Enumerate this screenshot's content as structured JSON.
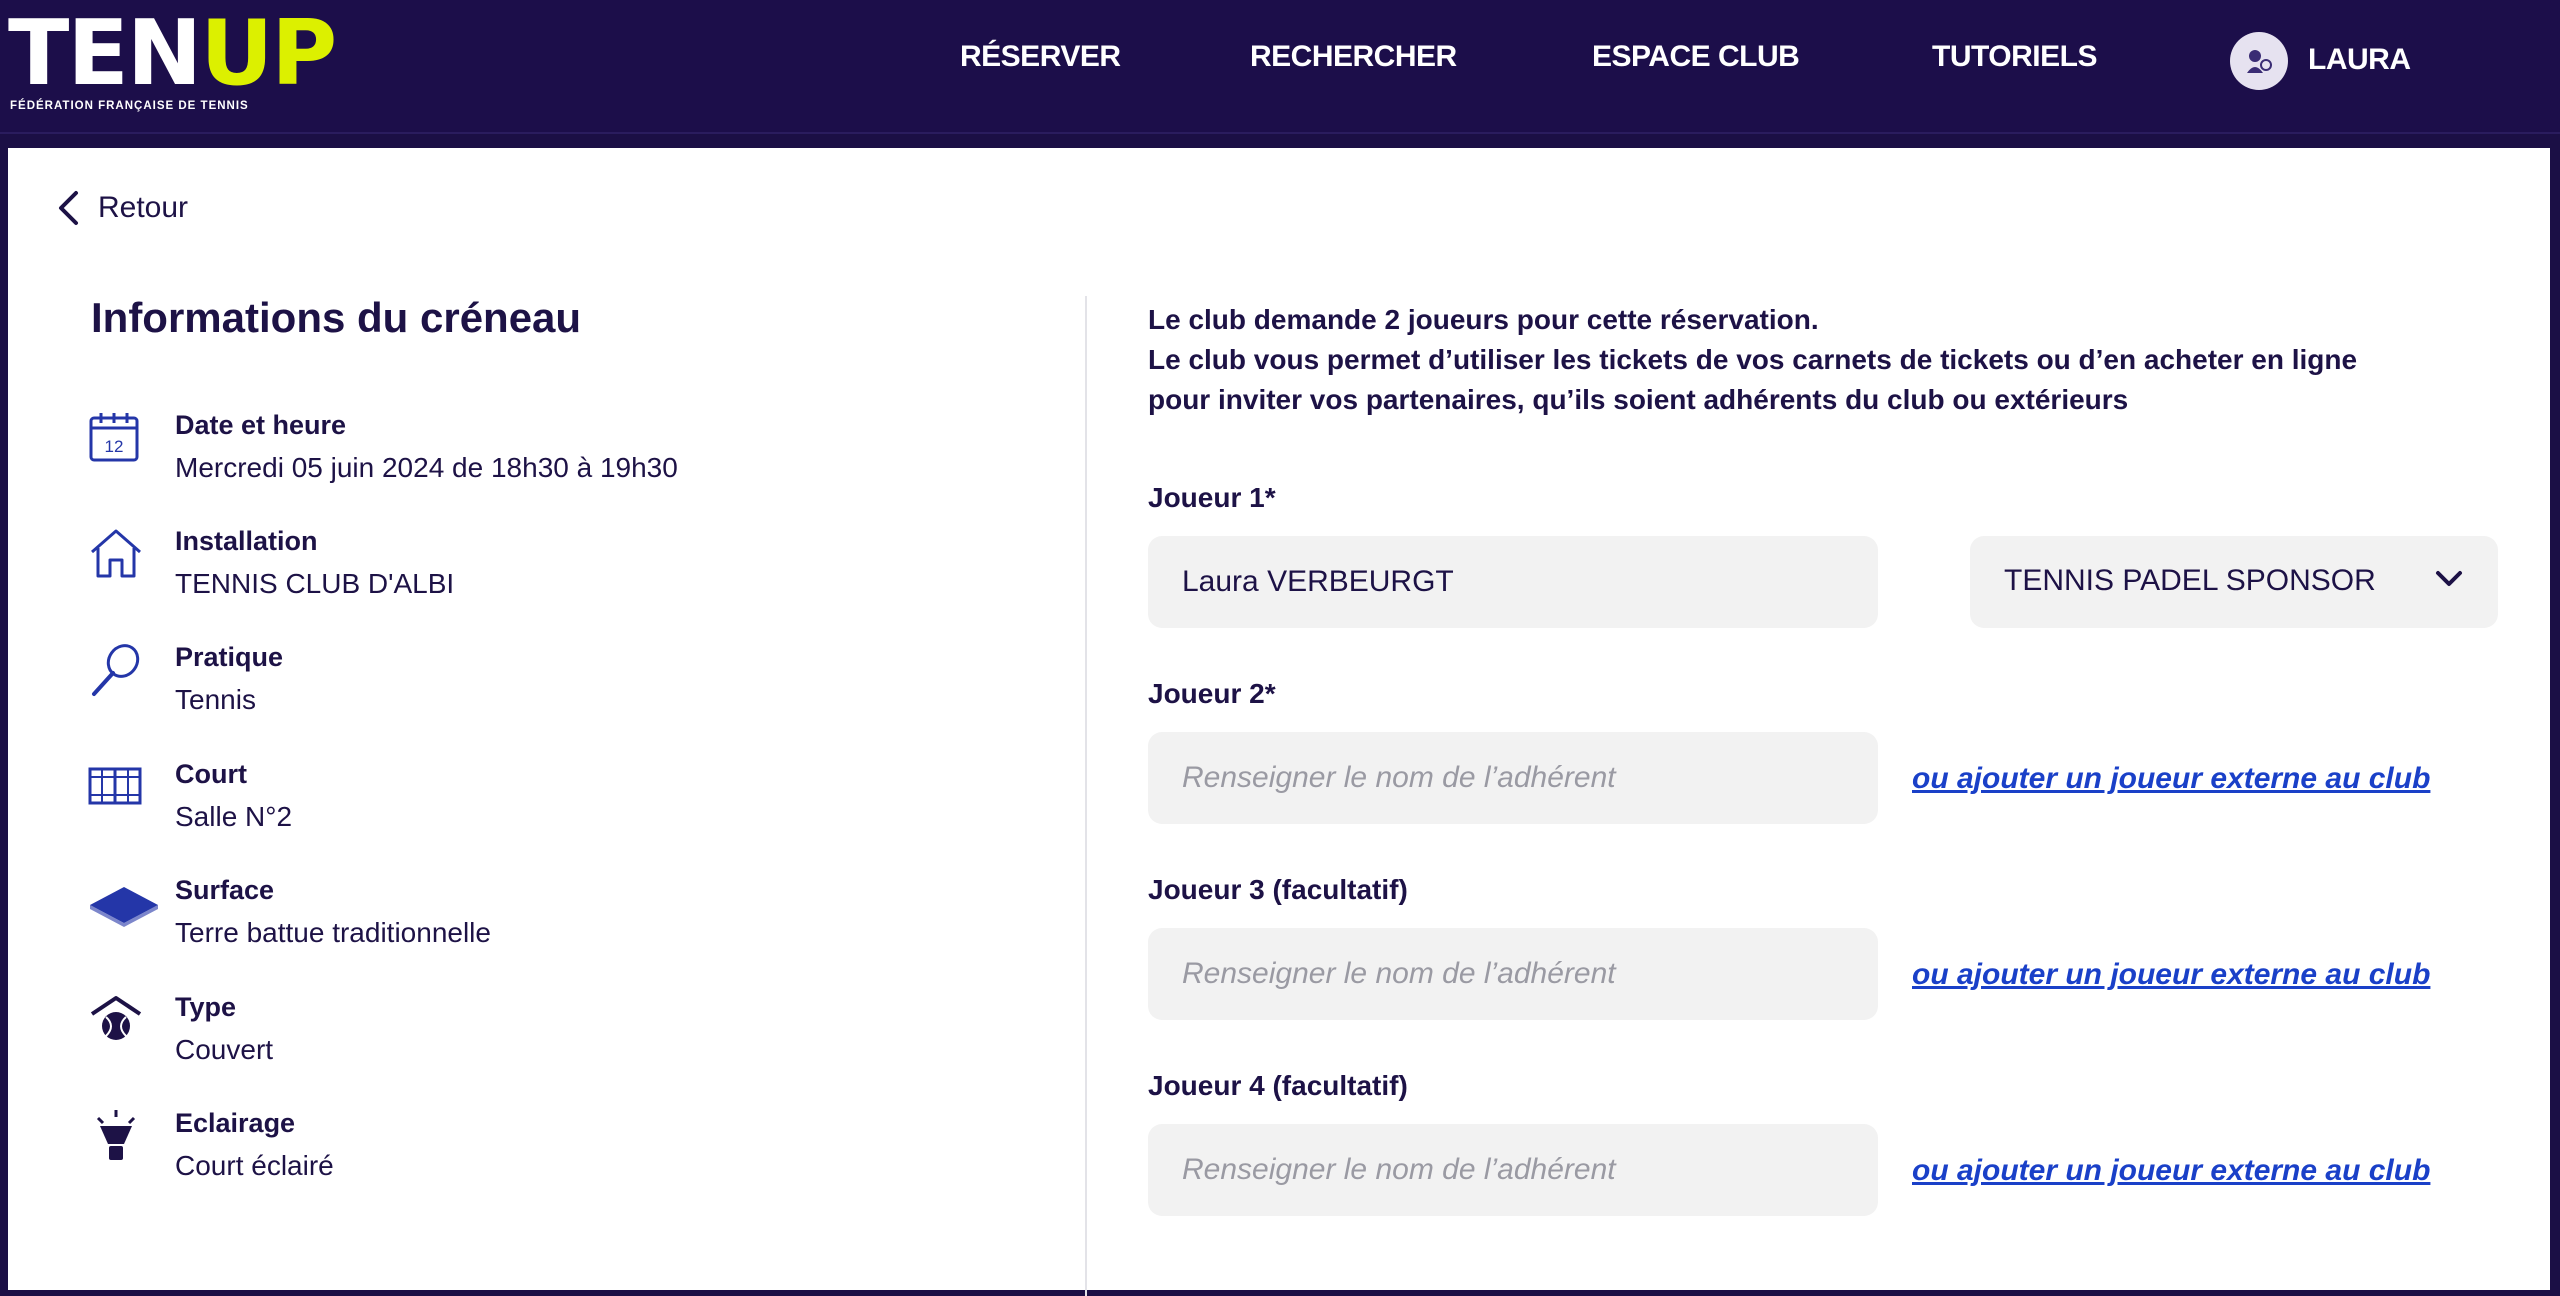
{
  "header": {
    "logo": {
      "ten": "TEN",
      "up": "UP",
      "subtitle": "FÉDÉRATION FRANÇAISE DE TENNIS"
    },
    "nav": [
      {
        "label": "RÉSERVER"
      },
      {
        "label": "RECHERCHER"
      },
      {
        "label": "ESPACE CLUB"
      },
      {
        "label": "TUTORIELS"
      }
    ],
    "user": {
      "name": "LAURA"
    }
  },
  "back": {
    "label": "Retour"
  },
  "slot": {
    "title": "Informations du créneau",
    "rows": [
      {
        "icon": "calendar-icon",
        "label": "Date et heure",
        "value": "Mercredi 05 juin 2024 de 18h30 à 19h30",
        "icon_text": "12"
      },
      {
        "icon": "house-icon",
        "label": "Installation",
        "value": "TENNIS CLUB D'ALBI"
      },
      {
        "icon": "racket-icon",
        "label": "Pratique",
        "value": "Tennis"
      },
      {
        "icon": "court-icon",
        "label": "Court",
        "value": "Salle N°2"
      },
      {
        "icon": "surface-icon",
        "label": "Surface",
        "value": "Terre battue traditionnelle"
      },
      {
        "icon": "covered-icon",
        "label": "Type",
        "value": "Couvert"
      },
      {
        "icon": "light-icon",
        "label": "Eclairage",
        "value": "Court éclairé"
      }
    ]
  },
  "booking": {
    "intro": [
      "Le club demande 2 joueurs pour cette réservation.",
      "Le club vous permet d’utiliser les tickets de vos carnets de tickets ou d’en acheter en ligne",
      "pour inviter vos partenaires, qu’ils soient adhérents du club ou extérieurs"
    ],
    "players": [
      {
        "label": "Joueur 1*",
        "value": "Laura VERBEURGT",
        "placeholder": "",
        "select": "TENNIS PADEL SPONSOR"
      },
      {
        "label": "Joueur 2*",
        "value": "",
        "placeholder": "Renseigner le nom de l’adhérent",
        "link": "ou ajouter un joueur externe au club"
      },
      {
        "label": "Joueur 3 (facultatif)",
        "value": "",
        "placeholder": "Renseigner le nom de l’adhérent",
        "link": "ou ajouter un joueur externe au club"
      },
      {
        "label": "Joueur 4 (facultatif)",
        "value": "",
        "placeholder": "Renseigner le nom de l’adhérent",
        "link": "ou ajouter un joueur externe au club"
      }
    ]
  },
  "colors": {
    "header_bg": "#1c0e4a",
    "accent_yellow": "#dcf000",
    "link_blue": "#1a40c8",
    "field_bg": "#f2f2f2"
  }
}
